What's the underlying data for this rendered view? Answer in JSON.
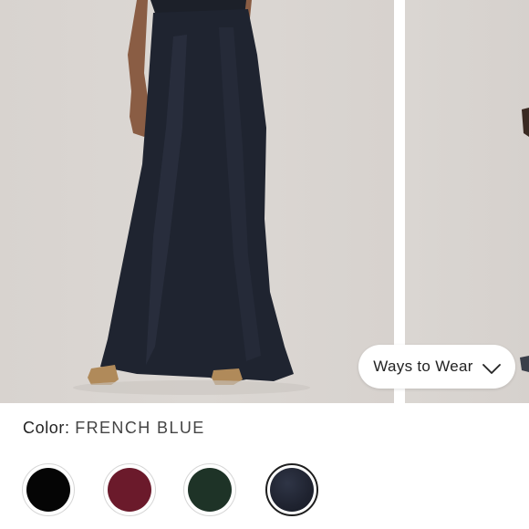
{
  "product": {
    "color_label": "Color:",
    "color_value": "FRENCH BLUE"
  },
  "gallery": {
    "ways_to_wear_label": "Ways to Wear",
    "ways_to_wear_icon": "chevron-down-icon"
  },
  "swatches": [
    {
      "name": "black",
      "color": "#050505",
      "selected": false
    },
    {
      "name": "burgundy",
      "color": "#6b1a2b",
      "selected": false
    },
    {
      "name": "dark-green",
      "color": "#1e3327",
      "selected": false
    },
    {
      "name": "french-blue",
      "color": "#1f2330",
      "selected": true
    }
  ],
  "colors": {
    "background": "#ffffff",
    "photo_backdrop": "#dad6d2",
    "skirt": "#1f2430",
    "text": "#222222"
  }
}
